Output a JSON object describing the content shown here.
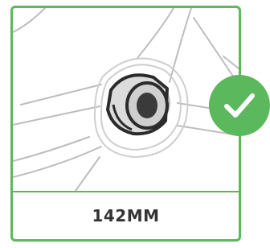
{
  "option": {
    "label": "142MM",
    "selected": true,
    "accent_color": "#5cb85c",
    "check_icon": "checkmark-icon",
    "illustration_icon": "bottom-bracket-spacer-illustration"
  }
}
